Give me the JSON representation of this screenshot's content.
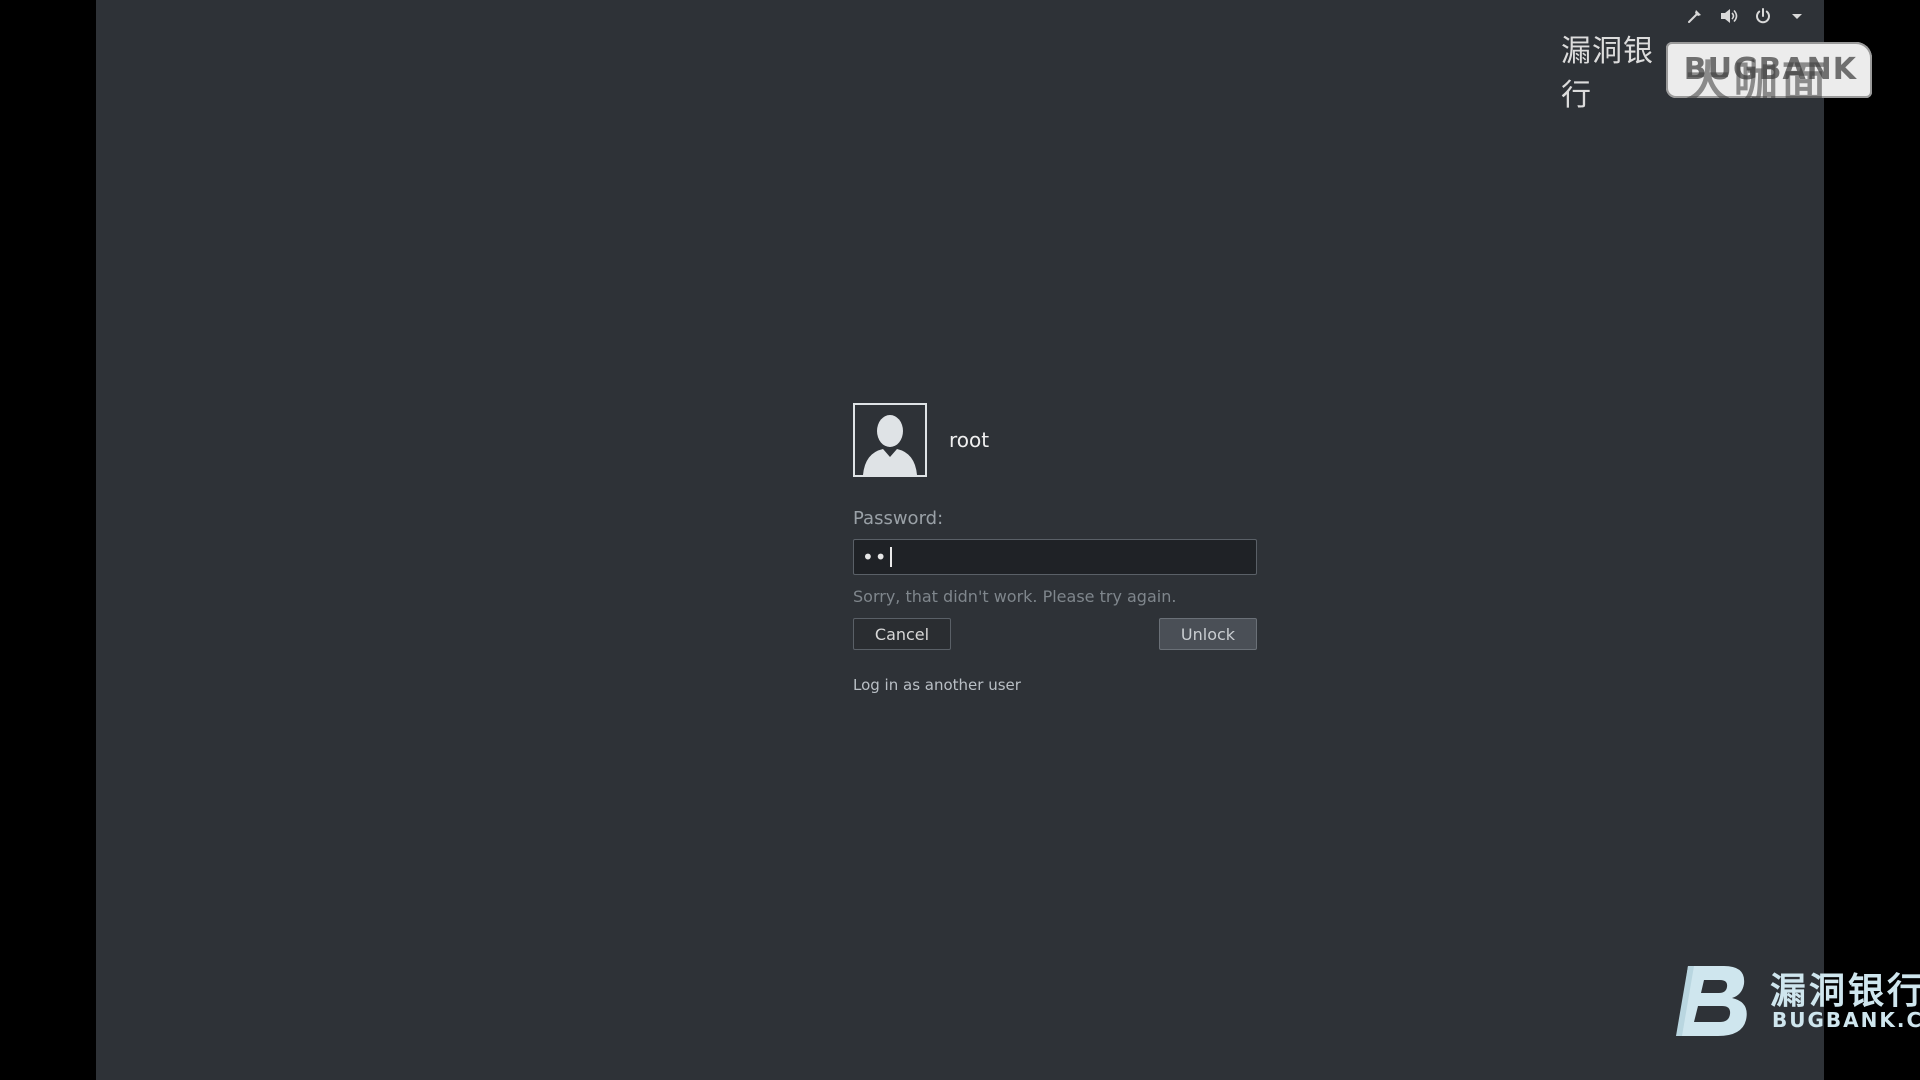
{
  "tray": {
    "icons": [
      "tool-icon",
      "volume-icon",
      "power-icon",
      "caret-down-icon"
    ]
  },
  "watermark_top": {
    "cn": "漏洞银行",
    "en": "BUGBANK",
    "overlay_cn": "大咖面对面"
  },
  "login": {
    "username": "root",
    "password_label": "Password:",
    "password_value": "••",
    "error_message": "Sorry, that didn't work. Please try again.",
    "cancel_label": "Cancel",
    "unlock_label": "Unlock",
    "another_user_label": "Log in as another user"
  },
  "watermark_bottom": {
    "cn": "漏洞银行",
    "en": "BUGBANK.CN"
  },
  "colors": {
    "background": "#2e3237",
    "text": "#f0f0f0",
    "muted": "#9aa1a7"
  }
}
